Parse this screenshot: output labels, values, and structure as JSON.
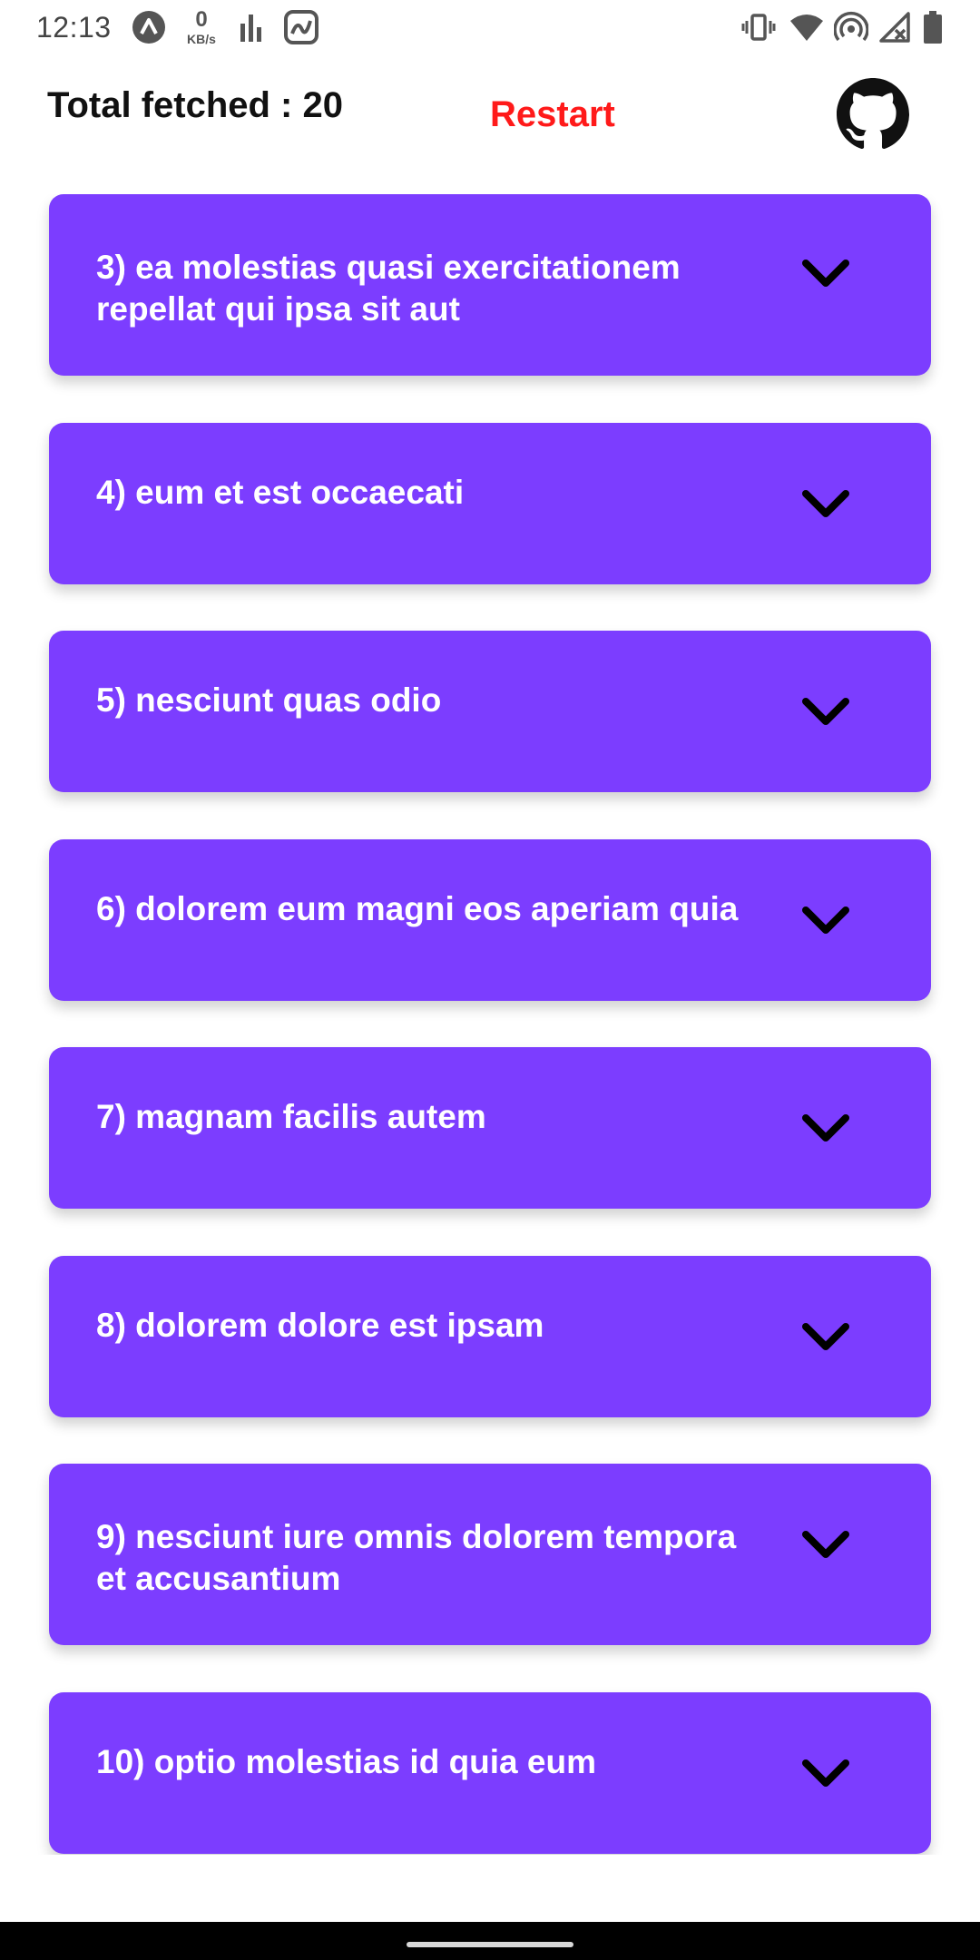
{
  "status_bar": {
    "time": "12:13",
    "net_speed_value": "0",
    "net_speed_unit": "KB/s",
    "icons": [
      "app-a-icon",
      "signal-bars-icon",
      "app-tile-icon",
      "vibrate-icon",
      "wifi-icon",
      "hotspot-icon",
      "cell-signal-off-icon",
      "battery-icon"
    ]
  },
  "header": {
    "total_label": "Total fetched : 20",
    "restart_label": "Restart",
    "github_icon": "github-icon",
    "restart_color": "#ff1a1a"
  },
  "list": {
    "accent_color": "#7c3dff",
    "items": [
      {
        "title": "3) ea molestias quasi exercitationem repellat qui ipsa sit aut"
      },
      {
        "title": "4) eum et est occaecati"
      },
      {
        "title": "5) nesciunt quas odio"
      },
      {
        "title": "6) dolorem eum magni eos aperiam quia"
      },
      {
        "title": "7) magnam facilis autem"
      },
      {
        "title": "8) dolorem dolore est ipsam"
      },
      {
        "title": "9) nesciunt iure omnis dolorem tempora et accusantium"
      },
      {
        "title": "10) optio molestias id quia eum"
      }
    ]
  }
}
